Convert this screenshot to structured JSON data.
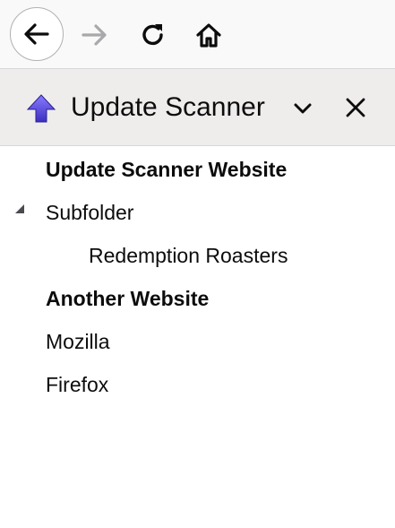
{
  "toolbar": {
    "back_icon": "arrow-left-icon",
    "forward_icon": "arrow-right-icon",
    "reload_icon": "reload-icon",
    "home_icon": "home-icon"
  },
  "sidebar": {
    "icon": "update-scanner-arrow-icon",
    "title": "Update Scanner",
    "chevron_icon": "chevron-down-icon",
    "close_icon": "close-icon"
  },
  "tree": {
    "items": [
      {
        "label": "Update Scanner Website",
        "bold": true
      },
      {
        "label": "Subfolder",
        "bold": false,
        "expanded": true
      },
      {
        "label": "Redemption Roasters",
        "bold": false
      },
      {
        "label": "Another Website",
        "bold": true
      },
      {
        "label": "Mozilla",
        "bold": false
      },
      {
        "label": "Firefox",
        "bold": false
      }
    ]
  },
  "colors": {
    "accent": "#5b3fd6",
    "text": "#0c0c0d",
    "header_bg": "#efedec",
    "disabled": "#a9a9ab"
  }
}
